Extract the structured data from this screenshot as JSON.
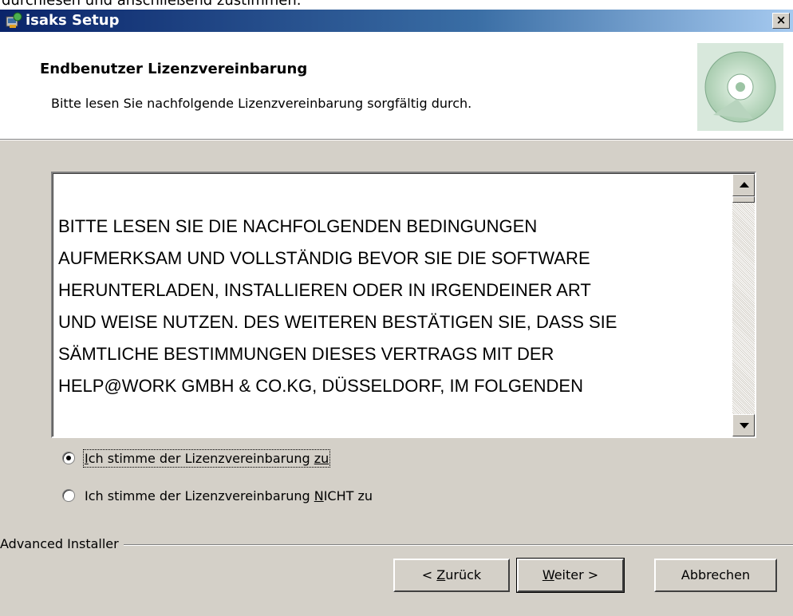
{
  "background_text": "durchlesen und anschließend zustimmen.",
  "window": {
    "title": "isaks Setup",
    "close_label": "×"
  },
  "header": {
    "title": "Endbenutzer Lizenzvereinbarung",
    "subtitle": "Bitte lesen Sie nachfolgende Lizenzvereinbarung sorgfältig durch."
  },
  "license": {
    "text": "BITTE LESEN SIE DIE NACHFOLGENDEN BEDINGUNGEN\nAUFMERKSAM UND VOLLSTÄNDIG BEVOR SIE DIE SOFTWARE\nHERUNTERLADEN, INSTALLIEREN ODER IN IRGENDEINER ART\nUND WEISE NUTZEN. DES WEITEREN BESTÄTIGEN SIE, DASS SIE\nSÄMTLICHE BESTIMMUNGEN DIESES VERTRAGS MIT DER\nHELP@WORK GMBH & CO.KG, DÜSSELDORF, IM FOLGENDEN"
  },
  "options": {
    "accept": {
      "prefix_u": "I",
      "text": "ch stimme der Lizenzvereinbarung ",
      "suffix_u": "zu",
      "suffix": "",
      "selected": true
    },
    "decline": {
      "prefix": "Ich stimme der Lizenzvereinbarung ",
      "u": "N",
      "rest": "ICHT zu",
      "selected": false
    }
  },
  "footer": {
    "group_label": "Advanced Installer"
  },
  "buttons": {
    "back": {
      "pre": "< ",
      "u": "Z",
      "rest": "urück"
    },
    "next": {
      "u": "W",
      "rest": "eiter >"
    },
    "cancel": "Abbrechen"
  }
}
